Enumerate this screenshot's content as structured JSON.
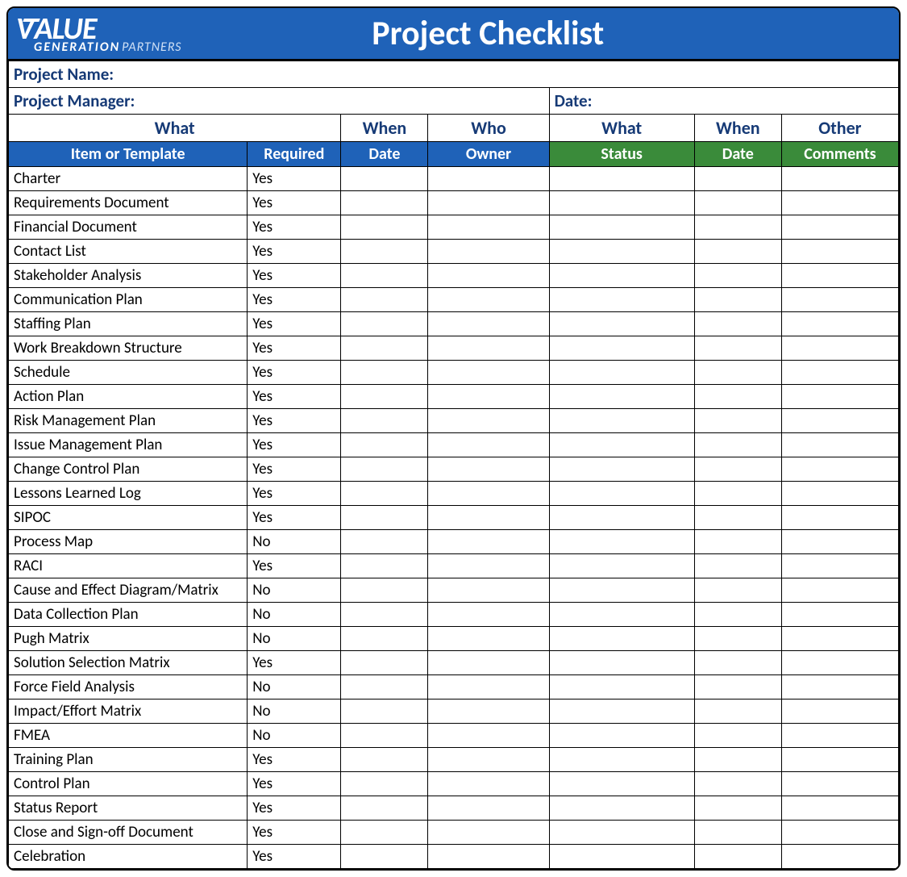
{
  "banner": {
    "logo_word": "ALUE",
    "logo_gen": "GENERATION",
    "logo_partners": "PARTNERS",
    "title": "Project Checklist"
  },
  "info": {
    "project_name_label": "Project Name:",
    "project_manager_label": "Project Manager:",
    "date_label": "Date:"
  },
  "group_headers": {
    "what1": "What",
    "when1": "When",
    "who": "Who",
    "what2": "What",
    "when2": "When",
    "other": "Other"
  },
  "col_headers": {
    "item": "Item or Template",
    "required": "Required",
    "date1": "Date",
    "owner": "Owner",
    "status": "Status",
    "date2": "Date",
    "comments": "Comments"
  },
  "rows": [
    {
      "item": "Charter",
      "required": "Yes"
    },
    {
      "item": "Requirements Document",
      "required": "Yes"
    },
    {
      "item": "Financial Document",
      "required": "Yes"
    },
    {
      "item": "Contact List",
      "required": "Yes"
    },
    {
      "item": "Stakeholder Analysis",
      "required": "Yes"
    },
    {
      "item": "Communication Plan",
      "required": "Yes"
    },
    {
      "item": "Staffing Plan",
      "required": "Yes"
    },
    {
      "item": "Work Breakdown Structure",
      "required": "Yes"
    },
    {
      "item": "Schedule",
      "required": "Yes"
    },
    {
      "item": "Action Plan",
      "required": "Yes"
    },
    {
      "item": "Risk Management Plan",
      "required": "Yes"
    },
    {
      "item": "Issue Management Plan",
      "required": "Yes"
    },
    {
      "item": "Change Control Plan",
      "required": "Yes"
    },
    {
      "item": "Lessons Learned Log",
      "required": "Yes"
    },
    {
      "item": "SIPOC",
      "required": "Yes"
    },
    {
      "item": "Process Map",
      "required": "No"
    },
    {
      "item": "RACI",
      "required": "Yes"
    },
    {
      "item": "Cause and Effect Diagram/Matrix",
      "required": "No"
    },
    {
      "item": "Data Collection Plan",
      "required": "No"
    },
    {
      "item": "Pugh Matrix",
      "required": "No"
    },
    {
      "item": "Solution Selection Matrix",
      "required": "Yes"
    },
    {
      "item": "Force Field Analysis",
      "required": "No"
    },
    {
      "item": "Impact/Effort Matrix",
      "required": "No"
    },
    {
      "item": "FMEA",
      "required": "No"
    },
    {
      "item": "Training Plan",
      "required": "Yes"
    },
    {
      "item": "Control Plan",
      "required": "Yes"
    },
    {
      "item": "Status Report",
      "required": "Yes"
    },
    {
      "item": "Close and Sign-off Document",
      "required": "Yes"
    },
    {
      "item": "Celebration",
      "required": "Yes"
    }
  ]
}
